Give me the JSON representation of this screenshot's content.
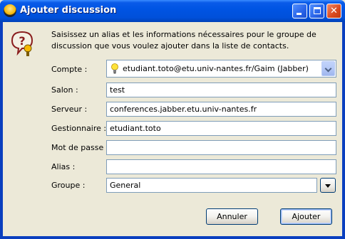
{
  "window": {
    "title": "Ajouter discussion"
  },
  "intro_text": "Saisissez un alias et les informations nécessaires pour le groupe de discussion que vous voulez ajouter dans la liste de contacts.",
  "form": {
    "compte": {
      "label": "Compte :",
      "value": "etudiant.toto@etu.univ-nantes.fr/Gaim (Jabber)"
    },
    "salon": {
      "label": "Salon :",
      "value": "test"
    },
    "serveur": {
      "label": "Serveur :",
      "value": "conferences.jabber.etu.univ-nantes.fr"
    },
    "gestionnaire": {
      "label": "Gestionnaire :",
      "value": "etudiant.toto"
    },
    "mot_de_passe": {
      "label": "Mot de passe :",
      "value": ""
    },
    "alias": {
      "label": "Alias :",
      "value": ""
    },
    "groupe": {
      "label": "Groupe :",
      "value": "General"
    }
  },
  "buttons": {
    "annuler": "Annuler",
    "ajouter": "Ajouter"
  },
  "colors": {
    "titlebar": "#0054E3",
    "client": "#ECE9D8",
    "field_border": "#7F9DB9",
    "close_button": "#D9491E"
  }
}
